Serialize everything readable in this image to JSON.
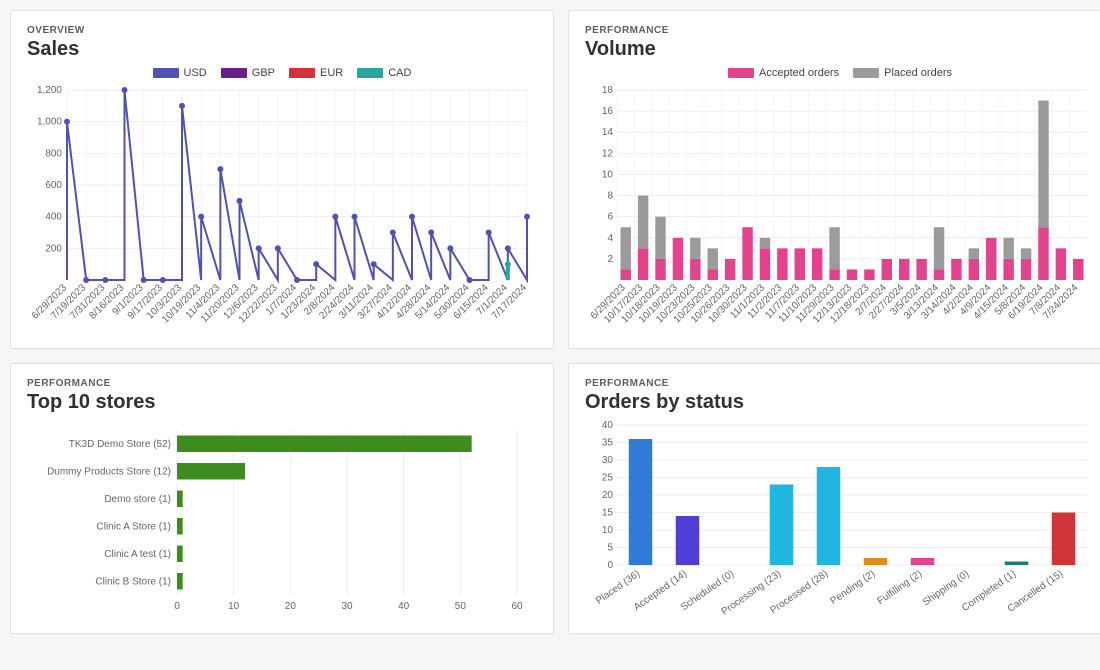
{
  "sales_panel": {
    "eyebrow": "OVERVIEW",
    "title": "Sales"
  },
  "volume_panel": {
    "eyebrow": "PERFORMANCE",
    "title": "Volume"
  },
  "stores_panel": {
    "eyebrow": "PERFORMANCE",
    "title": "Top 10 stores"
  },
  "orders_panel": {
    "eyebrow": "PERFORMANCE",
    "title": "Orders by status"
  },
  "chart_data": [
    {
      "id": "sales",
      "type": "line",
      "title": "Sales",
      "ylim": [
        0,
        1200
      ],
      "yticks": [
        200,
        400,
        600,
        800,
        1000,
        1200
      ],
      "legend": [
        {
          "name": "USD",
          "color": "#4F52B2"
        },
        {
          "name": "GBP",
          "color": "#6B1E8C"
        },
        {
          "name": "EUR",
          "color": "#D13438"
        },
        {
          "name": "CAD",
          "color": "#2AA6A0"
        }
      ],
      "series": [
        {
          "name": "USD",
          "color": "#4F52B2",
          "points": [
            {
              "x": "6/29/2023",
              "y": 1000
            },
            {
              "x": "7/19/2023",
              "y": 0
            },
            {
              "x": "7/31/2023",
              "y": 0
            },
            {
              "x": "8/16/2023",
              "y": 1200
            },
            {
              "x": "9/1/2023",
              "y": 0
            },
            {
              "x": "9/17/2023",
              "y": 0
            },
            {
              "x": "10/3/2023",
              "y": 1100
            },
            {
              "x": "10/19/2023",
              "y": 400
            },
            {
              "x": "11/4/2023",
              "y": 700
            },
            {
              "x": "11/20/2023",
              "y": 500
            },
            {
              "x": "12/6/2023",
              "y": 200
            },
            {
              "x": "12/22/2023",
              "y": 200
            },
            {
              "x": "1/7/2024",
              "y": 0
            },
            {
              "x": "1/23/2024",
              "y": 100
            },
            {
              "x": "2/8/2024",
              "y": 400
            },
            {
              "x": "2/24/2024",
              "y": 400
            },
            {
              "x": "3/11/2024",
              "y": 100
            },
            {
              "x": "3/27/2024",
              "y": 300
            },
            {
              "x": "4/12/2024",
              "y": 400
            },
            {
              "x": "4/28/2024",
              "y": 300
            },
            {
              "x": "5/14/2024",
              "y": 200
            },
            {
              "x": "5/30/2024",
              "y": 0
            },
            {
              "x": "6/15/2024",
              "y": 300
            },
            {
              "x": "7/1/2024",
              "y": 200
            },
            {
              "x": "7/17/2024",
              "y": 400
            }
          ]
        },
        {
          "name": "CAD",
          "color": "#2AA6A0",
          "points": [
            {
              "x": "7/1/2024",
              "y": 100
            }
          ]
        }
      ]
    },
    {
      "id": "volume",
      "type": "bar",
      "title": "Volume",
      "ylim": [
        0,
        18
      ],
      "yticks": [
        2,
        4,
        6,
        8,
        10,
        12,
        14,
        16,
        18
      ],
      "legend": [
        {
          "name": "Accepted orders",
          "color": "#E3438D"
        },
        {
          "name": "Placed orders",
          "color": "#9B9B9B"
        }
      ],
      "categories": [
        "6/29/2023",
        "10/17/2023",
        "10/18/2023",
        "10/19/2023",
        "10/23/2023",
        "10/25/2023",
        "10/26/2023",
        "10/30/2023",
        "11/1/2023",
        "11/2/2023",
        "11/7/2023",
        "11/10/2023",
        "11/29/2023",
        "12/13/2023",
        "12/18/2023",
        "2/7/2024",
        "2/27/2024",
        "3/5/2024",
        "3/13/2024",
        "3/14/2024",
        "4/2/2024",
        "4/9/2024",
        "4/15/2024",
        "5/8/2024",
        "6/19/2024",
        "7/8/2024",
        "7/24/2024"
      ],
      "series": [
        {
          "name": "Accepted orders",
          "color": "#E3438D",
          "values": [
            1,
            3,
            2,
            4,
            2,
            1,
            2,
            5,
            3,
            3,
            3,
            3,
            1,
            1,
            1,
            2,
            2,
            2,
            1,
            2,
            2,
            4,
            2,
            2,
            5,
            3,
            2
          ]
        },
        {
          "name": "Placed orders",
          "color": "#9B9B9B",
          "values": [
            4,
            5,
            4,
            0,
            2,
            2,
            0,
            0,
            1,
            0,
            0,
            0,
            4,
            0,
            0,
            0,
            0,
            0,
            4,
            0,
            1,
            0,
            2,
            1,
            12,
            0,
            0
          ]
        }
      ]
    },
    {
      "id": "stores",
      "type": "bar-horizontal",
      "title": "Top 10 stores",
      "xlim": [
        0,
        60
      ],
      "xticks": [
        0,
        10,
        20,
        30,
        40,
        50,
        60
      ],
      "color": "#3E8C1E",
      "data": [
        {
          "label": "TK3D Demo Store (52)",
          "value": 52
        },
        {
          "label": "Dummy Products Store (12)",
          "value": 12
        },
        {
          "label": "Demo store (1)",
          "value": 1
        },
        {
          "label": "Clinic A Store (1)",
          "value": 1
        },
        {
          "label": "Clinic A test (1)",
          "value": 1
        },
        {
          "label": "Clinic B Store (1)",
          "value": 1
        }
      ]
    },
    {
      "id": "orders",
      "type": "bar",
      "title": "Orders by status",
      "ylim": [
        0,
        40
      ],
      "yticks": [
        0,
        5,
        10,
        15,
        20,
        25,
        30,
        35,
        40
      ],
      "data": [
        {
          "label": "Placed (36)",
          "value": 36,
          "color": "#2E7CD6"
        },
        {
          "label": "Accepted (14)",
          "value": 14,
          "color": "#4F3FD4"
        },
        {
          "label": "Scheduled (0)",
          "value": 0,
          "color": "#666666"
        },
        {
          "label": "Processing (23)",
          "value": 23,
          "color": "#1FB6E0"
        },
        {
          "label": "Processed (28)",
          "value": 28,
          "color": "#1FB6E0"
        },
        {
          "label": "Pending (2)",
          "value": 2,
          "color": "#E38B1F"
        },
        {
          "label": "Fulfilling (2)",
          "value": 2,
          "color": "#E3438D"
        },
        {
          "label": "Shipping (0)",
          "value": 0,
          "color": "#666666"
        },
        {
          "label": "Completed (1)",
          "value": 1,
          "color": "#1E7A6B"
        },
        {
          "label": "Cancelled (15)",
          "value": 15,
          "color": "#D13438"
        }
      ]
    }
  ]
}
